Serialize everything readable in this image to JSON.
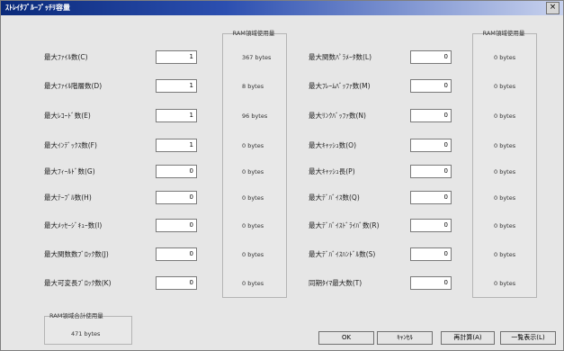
{
  "window": {
    "title": "ｽﾄﾚｲﾀﾌﾞﾙｰﾌﾟｯﾁﾘ容量",
    "close": "×"
  },
  "left_fields": [
    {
      "label": "最大ﾌｧｲﾙ数(C)",
      "value": "1",
      "usage": "367 bytes"
    },
    {
      "label": "最大ﾌｧｲﾙ階層数(D)",
      "value": "1",
      "usage": "8 bytes"
    },
    {
      "label": "最大ﾚｺｰﾄﾞ数(E)",
      "value": "1",
      "usage": "96 bytes"
    },
    {
      "label": "最大ｲﾝﾃﾞｯｸｽ数(F)",
      "value": "1",
      "usage": "0 bytes"
    },
    {
      "label": "最大ﾌｨｰﾙﾄﾞ数(G)",
      "value": "0",
      "usage": "0 bytes"
    },
    {
      "label": "最大ﾃｰﾌﾞﾙ数(H)",
      "value": "0",
      "usage": "0 bytes"
    },
    {
      "label": "最大ﾒｯｾｰｼﾞｷｭｰ数(I)",
      "value": "0",
      "usage": "0 bytes"
    },
    {
      "label": "最大関数数ﾌﾞﾛｯｸ数(J)",
      "value": "0",
      "usage": "0 bytes"
    },
    {
      "label": "最大可変長ﾌﾞﾛｯｸ数(K)",
      "value": "0",
      "usage": "0 bytes"
    }
  ],
  "right_fields": [
    {
      "label": "最大関数ﾊﾟﾗﾒｰﾀ数(L)",
      "value": "0",
      "usage": "0 bytes"
    },
    {
      "label": "最大ﾌﾚｰﾑﾊﾞｯﾌｧ数(M)",
      "value": "0",
      "usage": "0 bytes"
    },
    {
      "label": "最大ﾘﾝｸﾊﾞｯﾌｧ数(N)",
      "value": "0",
      "usage": "0 bytes"
    },
    {
      "label": "最大ｷｬｯｼｭ数(O)",
      "value": "0",
      "usage": "0 bytes"
    },
    {
      "label": "最大ｷｬｯｼｭ長(P)",
      "value": "0",
      "usage": "0 bytes"
    },
    {
      "label": "最大ﾃﾞﾊﾞｲｽ数(Q)",
      "value": "0",
      "usage": "0 bytes"
    },
    {
      "label": "最大ﾃﾞﾊﾞｲｽﾄﾞﾗｲﾊﾞ数(R)",
      "value": "0",
      "usage": "0 bytes"
    },
    {
      "label": "最大ﾃﾞﾊﾞｲｽﾊﾝﾄﾞﾙ数(S)",
      "value": "0",
      "usage": "0 bytes"
    },
    {
      "label": "同期ﾀｲﾏ最大数(T)",
      "value": "0",
      "usage": "0 bytes"
    }
  ],
  "usage_header": "RAM領域使用量",
  "total": {
    "title": "RAM領域合計使用量",
    "value": "471 bytes"
  },
  "buttons": {
    "ok": "OK",
    "cancel": "ｷｬﾝｾﾙ",
    "recalc": "再計算(A)",
    "apply_all": "一覧表示(L)"
  }
}
